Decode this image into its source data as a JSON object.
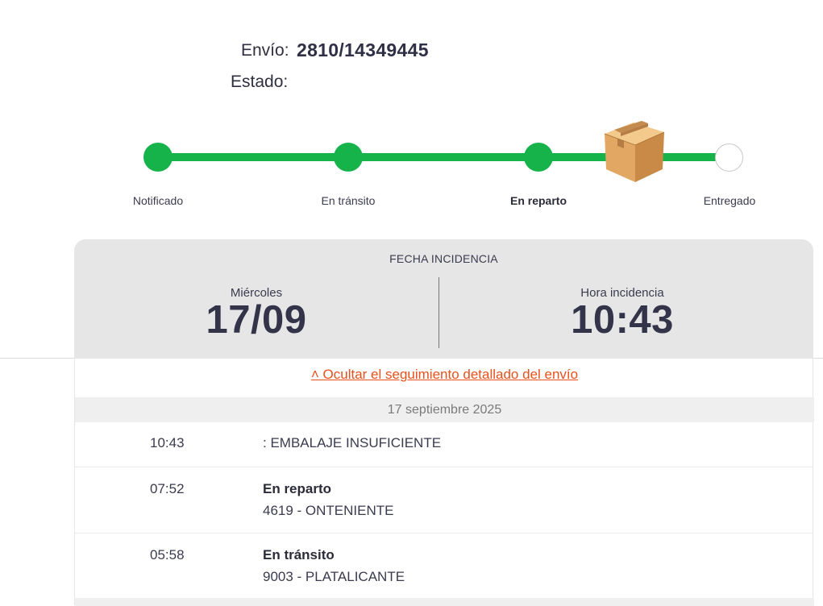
{
  "shipment": {
    "label": "Envío:",
    "number": "2810/14349445",
    "status_label": "Estado:"
  },
  "progress": {
    "steps": [
      {
        "label": "Notificado",
        "done": true
      },
      {
        "label": "En tránsito",
        "done": true
      },
      {
        "label": "En reparto",
        "done": true,
        "current": true
      },
      {
        "label": "Entregado",
        "done": false
      }
    ],
    "colors": {
      "done": "#16b24a",
      "pending": "#ffffff"
    }
  },
  "incident": {
    "title": "FECHA INCIDENCIA",
    "weekday": "Miércoles",
    "date": "17/09",
    "time_label": "Hora incidencia",
    "time": "10:43"
  },
  "tracking": {
    "toggle_label": "˄ Ocultar el seguimiento detallado del envío",
    "date_header": "17 septiembre 2025",
    "events": [
      {
        "time": "10:43",
        "title": "",
        "text": ": EMBALAJE INSUFICIENTE"
      },
      {
        "time": "07:52",
        "title": "En reparto",
        "text": "4619 - ONTENIENTE"
      },
      {
        "time": "05:58",
        "title": "En tránsito",
        "text": "9003 - PLATALICANTE"
      }
    ]
  },
  "accent_color": "#e8501c"
}
